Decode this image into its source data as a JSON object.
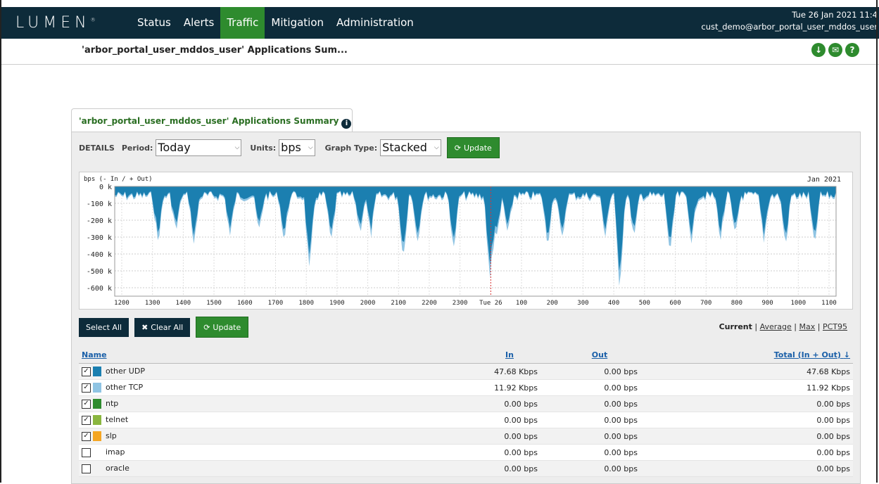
{
  "logo": "LUMEN",
  "nav": [
    "Status",
    "Alerts",
    "Traffic",
    "Mitigation",
    "Administration"
  ],
  "nav_active": "Traffic",
  "topright": {
    "date": "Tue 26 Jan 2021 11:4",
    "user": "cust_demo@arbor_portal_user_mddos_user"
  },
  "subheader": {
    "title": "'arbor_portal_user_mddos_user' Applications Sum..."
  },
  "header_icons": [
    "download-icon",
    "email-icon",
    "help-icon"
  ],
  "panel": {
    "tab_title": "'arbor_portal_user_mddos_user' Applications Summary",
    "details_label": "DETAILS",
    "period_label": "Period:",
    "period_value": "Today",
    "units_label": "Units:",
    "units_value": "bps",
    "graph_type_label": "Graph Type:",
    "graph_type_value": "Stacked",
    "update_label": "Update"
  },
  "chart_data": {
    "type": "area",
    "ylabel": "bps (- In / + Out)",
    "top_right_label": "Jan 2021",
    "y_ticks": [
      "0 k",
      "-100 k",
      "-200 k",
      "-300 k",
      "-400 k",
      "-500 k",
      "-600 k"
    ],
    "ylim": [
      -650,
      0
    ],
    "x_ticks": [
      "1200",
      "1300",
      "1400",
      "1500",
      "1600",
      "1700",
      "1800",
      "1900",
      "2000",
      "2100",
      "2200",
      "2300",
      "Tue 26",
      "100",
      "200",
      "300",
      "400",
      "500",
      "600",
      "700",
      "800",
      "900",
      "1000",
      "1100"
    ],
    "marker_label": "Tue 26",
    "series": [
      {
        "name": "other UDP",
        "color": "#1b7fb0"
      },
      {
        "name": "other TCP",
        "color": "#8fc4e3"
      }
    ]
  },
  "table": {
    "select_all": "Select All",
    "clear_all": "Clear All",
    "update": "Update",
    "views": {
      "current": "Current",
      "average": "Average",
      "max": "Max",
      "pct95": "PCT95",
      "sep": "|"
    },
    "headers": {
      "name": "Name",
      "in": "In",
      "out": "Out",
      "total": "Total (In + Out)"
    },
    "rows": [
      {
        "checked": true,
        "color": "#1b7fb0",
        "name": "other UDP",
        "in": "47.68 Kbps",
        "out": "0.00 bps",
        "total": "47.68 Kbps"
      },
      {
        "checked": true,
        "color": "#8fc4e3",
        "name": "other TCP",
        "in": "11.92 Kbps",
        "out": "0.00 bps",
        "total": "11.92 Kbps"
      },
      {
        "checked": true,
        "color": "#2e8b2e",
        "name": "ntp",
        "in": "0.00 bps",
        "out": "0.00 bps",
        "total": "0.00 bps"
      },
      {
        "checked": true,
        "color": "#8ab63f",
        "name": "telnet",
        "in": "0.00 bps",
        "out": "0.00 bps",
        "total": "0.00 bps"
      },
      {
        "checked": true,
        "color": "#f5a623",
        "name": "slp",
        "in": "0.00 bps",
        "out": "0.00 bps",
        "total": "0.00 bps"
      },
      {
        "checked": false,
        "color": "",
        "name": "imap",
        "in": "0.00 bps",
        "out": "0.00 bps",
        "total": "0.00 bps"
      },
      {
        "checked": false,
        "color": "",
        "name": "oracle",
        "in": "0.00 bps",
        "out": "0.00 bps",
        "total": "0.00 bps"
      }
    ]
  }
}
